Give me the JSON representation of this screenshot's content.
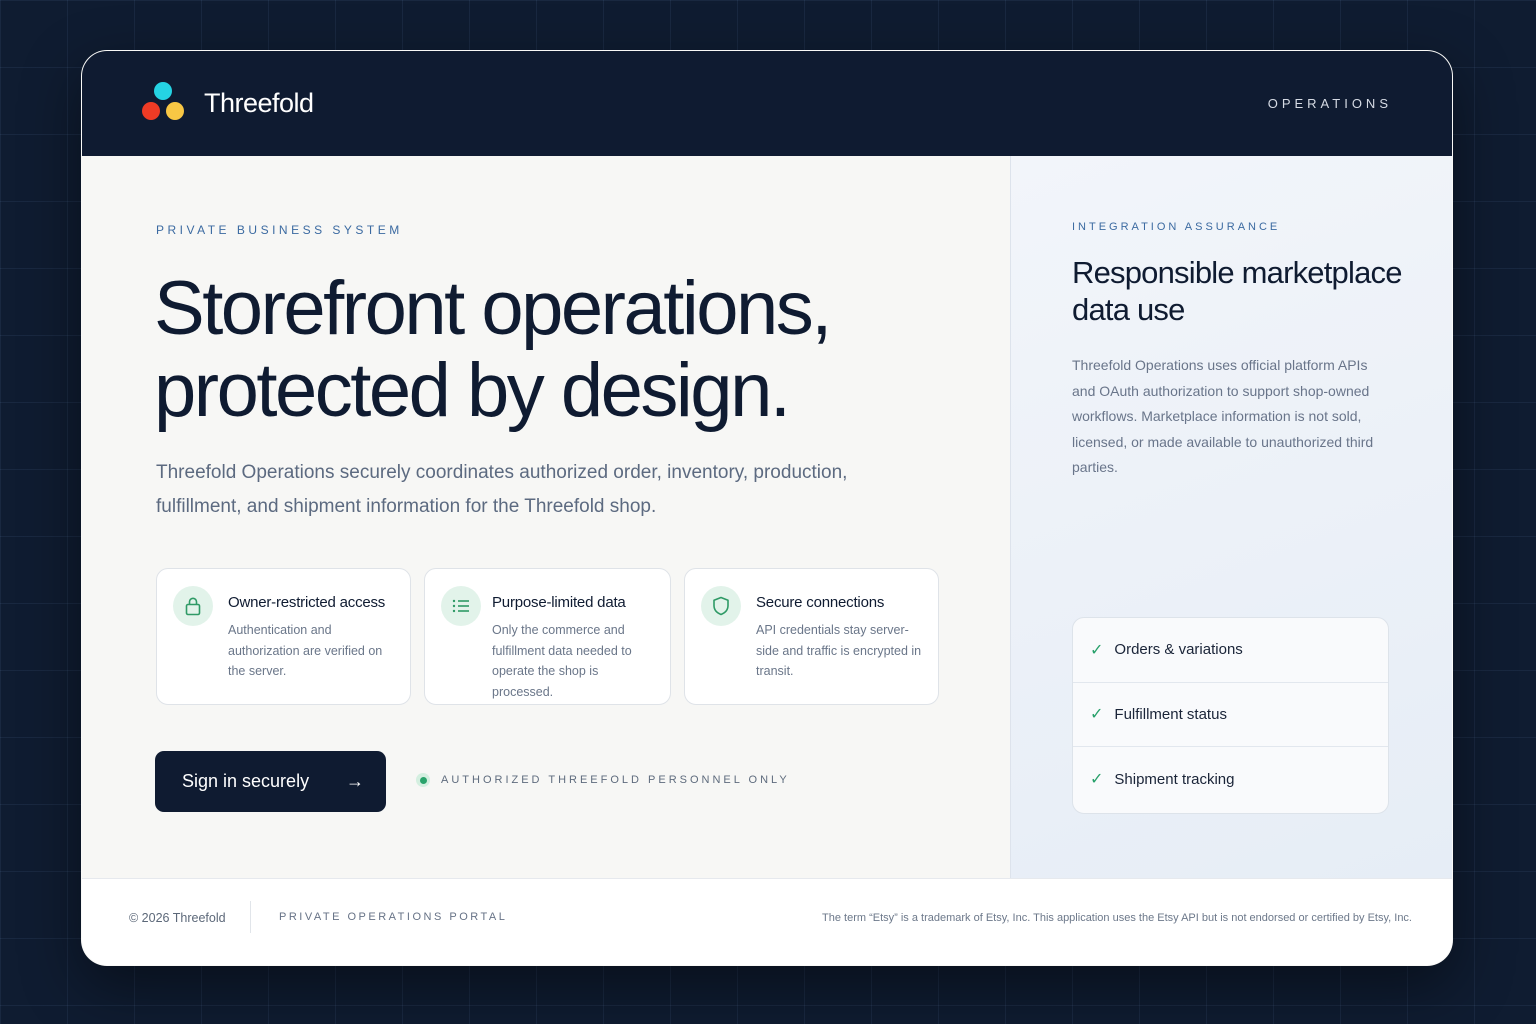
{
  "header": {
    "brand": "Threefold",
    "nav_label": "OPERATIONS"
  },
  "hero": {
    "eyebrow": "PRIVATE BUSINESS SYSTEM",
    "headline_line1": "Storefront operations,",
    "headline_line2": "protected by design.",
    "lede": "Threefold Operations securely coordinates authorized order, inventory, production, fulfillment, and shipment information for the Threefold shop."
  },
  "features": [
    {
      "icon": "lock-icon",
      "title": "Owner-restricted access",
      "description": "Authentication and authorization are verified on the server."
    },
    {
      "icon": "list-icon",
      "title": "Purpose-limited data",
      "description": "Only the commerce and fulfillment data needed to operate the shop is processed."
    },
    {
      "icon": "shield-icon",
      "title": "Secure connections",
      "description": "API credentials stay server-side and traffic is encrypted in transit."
    }
  ],
  "cta": {
    "label": "Sign in securely",
    "arrow": "→",
    "note": "AUTHORIZED THREEFOLD PERSONNEL ONLY"
  },
  "assurance": {
    "eyebrow": "INTEGRATION ASSURANCE",
    "title": "Responsible marketplace data use",
    "body": "Threefold Operations uses official platform APIs and OAuth authorization to support shop-owned workflows. Marketplace information is not sold, licensed, or made available to unauthorized third parties.",
    "check_symbol": "✓",
    "checklist": [
      "Orders & variations",
      "Fulfillment status",
      "Shipment tracking"
    ]
  },
  "footer": {
    "copyright": "© 2026 Threefold",
    "portal": "PRIVATE OPERATIONS PORTAL",
    "legal": "The term “Etsy” is a trademark of Etsy, Inc. This application uses the Etsy API but is not endorsed or certified by Etsy, Inc."
  },
  "colors": {
    "navy": "#0f1b31",
    "accent_blue": "#3b6aa1",
    "success_green": "#27a06a",
    "logo_cyan": "#25d3e3",
    "logo_red": "#ee3b25",
    "logo_yellow": "#f8c744"
  }
}
